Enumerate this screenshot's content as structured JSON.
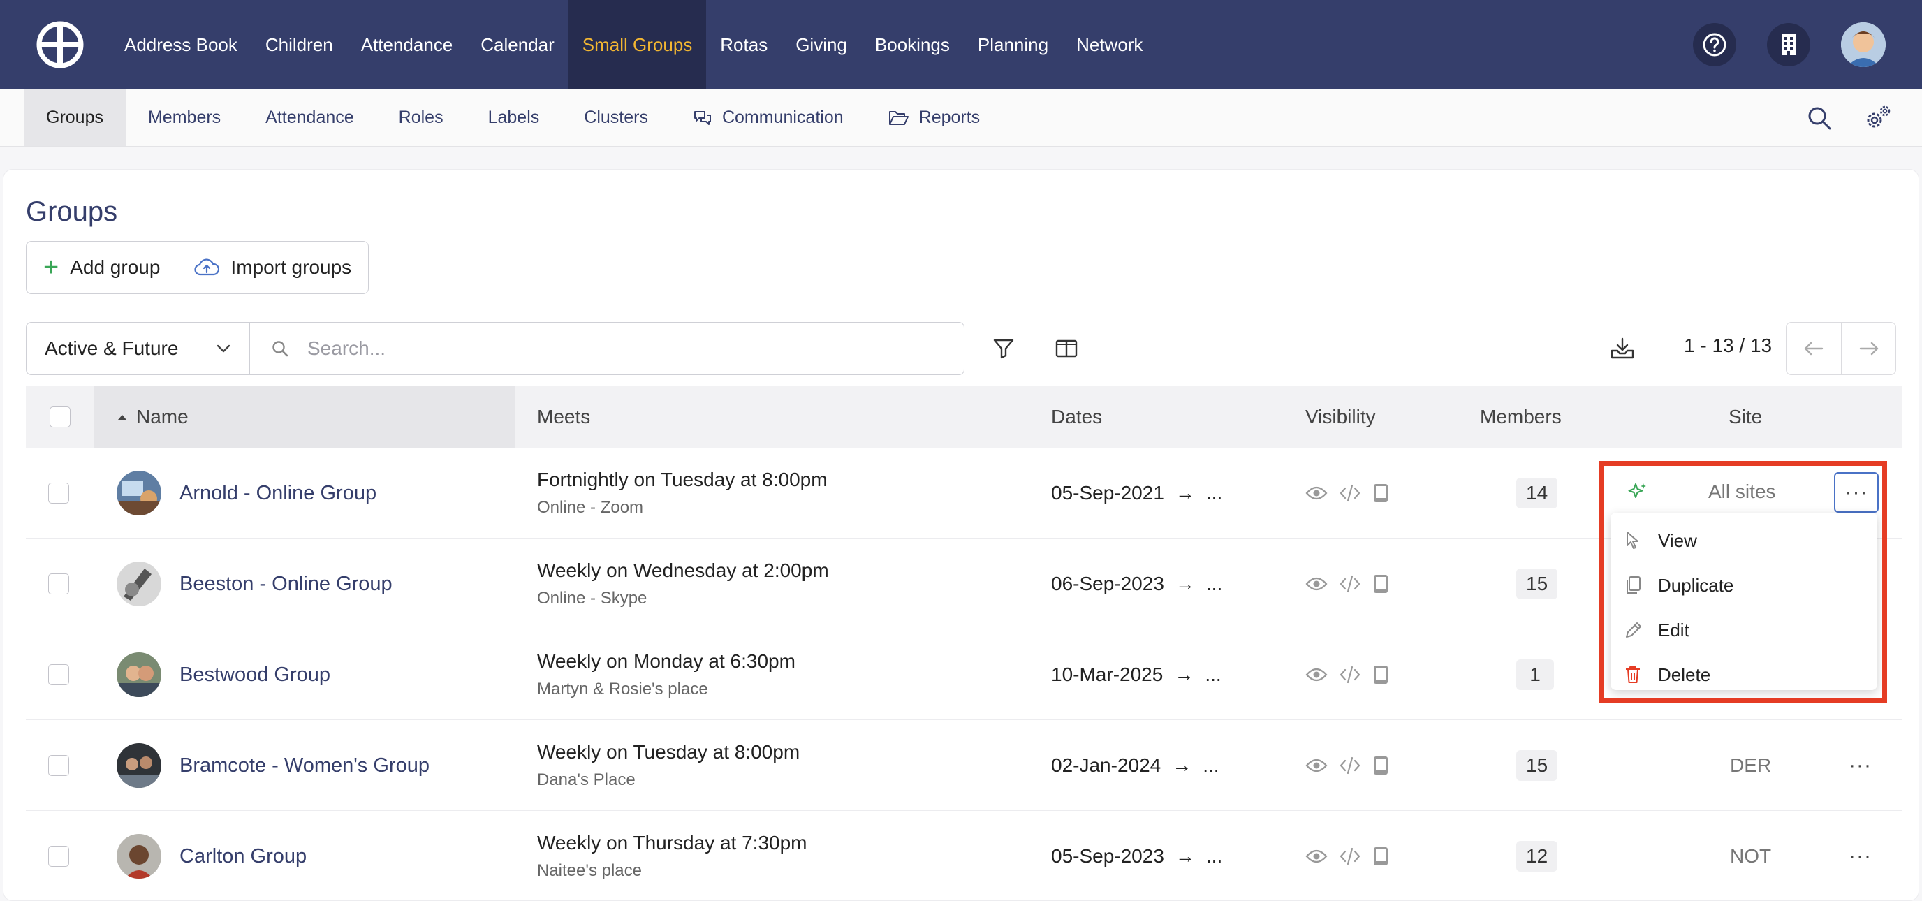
{
  "top_nav": {
    "items": [
      "Address Book",
      "Children",
      "Attendance",
      "Calendar",
      "Small Groups",
      "Rotas",
      "Giving",
      "Bookings",
      "Planning",
      "Network"
    ],
    "active_index": 4,
    "active_color": "#f2b632",
    "bg_color": "#353e6b"
  },
  "sub_nav": {
    "items": [
      "Groups",
      "Members",
      "Attendance",
      "Roles",
      "Labels",
      "Clusters",
      "Communication",
      "Reports"
    ],
    "active_index": 0
  },
  "page": {
    "title": "Groups",
    "add_label": "Add group",
    "import_label": "Import groups",
    "filter_value": "Active & Future",
    "search_placeholder": "Search...",
    "pagination": "1 - 13 / 13"
  },
  "table": {
    "headers": {
      "name": "Name",
      "meets": "Meets",
      "dates": "Dates",
      "visibility": "Visibility",
      "members": "Members",
      "site": "Site"
    },
    "rows": [
      {
        "name": "Arnold - Online Group",
        "meets": "Fortnightly on Tuesday at 8:00pm",
        "location": "Online - Zoom",
        "date": "05-Sep-2021",
        "end": "...",
        "members": "14",
        "site": "All sites"
      },
      {
        "name": "Beeston - Online Group",
        "meets": "Weekly on Wednesday at 2:00pm",
        "location": "Online - Skype",
        "date": "06-Sep-2023",
        "end": "...",
        "members": "15",
        "site": ""
      },
      {
        "name": "Bestwood Group",
        "meets": "Weekly on Monday at 6:30pm",
        "location": "Martyn & Rosie's place",
        "date": "10-Mar-2025",
        "end": "...",
        "members": "1",
        "site": ""
      },
      {
        "name": "Bramcote - Women's Group",
        "meets": "Weekly on Tuesday at 8:00pm",
        "location": "Dana's Place",
        "date": "02-Jan-2024",
        "end": "...",
        "members": "15",
        "site": "DER"
      },
      {
        "name": "Carlton Group",
        "meets": "Weekly on Thursday at 7:30pm",
        "location": "Naitee's place",
        "date": "05-Sep-2023",
        "end": "...",
        "members": "12",
        "site": "NOT"
      }
    ]
  },
  "row_menu": {
    "items": [
      "View",
      "Duplicate",
      "Edit",
      "Delete"
    ],
    "delete_color": "#e53c24",
    "highlight_color": "#e53c24"
  },
  "glyphs": {
    "arrow": "→",
    "dots": "···",
    "plus": "+"
  }
}
